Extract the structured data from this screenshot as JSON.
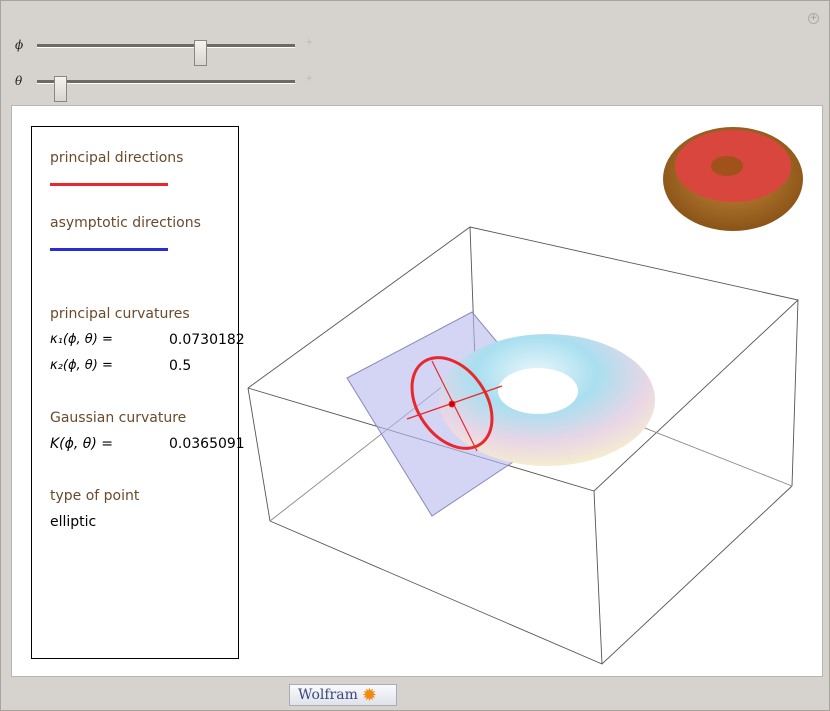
{
  "controls": {
    "phi": {
      "label": "ϕ",
      "value_fraction": 0.64
    },
    "theta": {
      "label": "θ",
      "value_fraction": 0.07
    }
  },
  "legend": {
    "principal_directions": "principal directions",
    "asymptotic_directions": "asymptotic directions",
    "principal_curvatures": "principal curvatures",
    "k1_label": "κ₁(ϕ, θ)  =",
    "k1_value": "0.0730182",
    "k2_label": "κ₂(ϕ, θ)  =",
    "k2_value": "0.5",
    "gaussian_curvature": "Gaussian curvature",
    "K_label": "K(ϕ, θ)  =",
    "K_value": "0.0365091",
    "type_of_point": "type of point",
    "type_value": "elliptic"
  },
  "colors": {
    "principal": "#e8282c",
    "asymptotic": "#2b2bd9",
    "heading": "#6b4a2c"
  },
  "footer": {
    "brand": "Wolfram"
  }
}
